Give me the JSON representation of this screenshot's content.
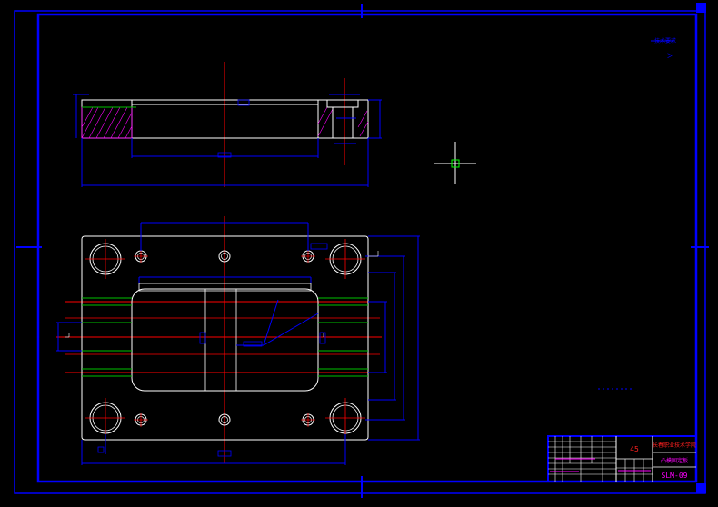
{
  "drawing": {
    "material": "45",
    "school_name": "长春职业技术学院",
    "part_name": "凸模固定板",
    "drawing_number": "SLM-09",
    "corner_note": "技术要求"
  },
  "colors": {
    "background": "#000000",
    "border": "#0000FF",
    "outline": "#FFFFFF",
    "centerline": "#FF0000",
    "dimension": "#0000FF",
    "hatch": "#FF00FF",
    "edge_green": "#00C000",
    "titleblock_text_red": "#FF2020",
    "titleblock_text_magenta": "#FF00FF",
    "crosshair": "#FFFFFF",
    "crosshair_box": "#00FF00"
  }
}
